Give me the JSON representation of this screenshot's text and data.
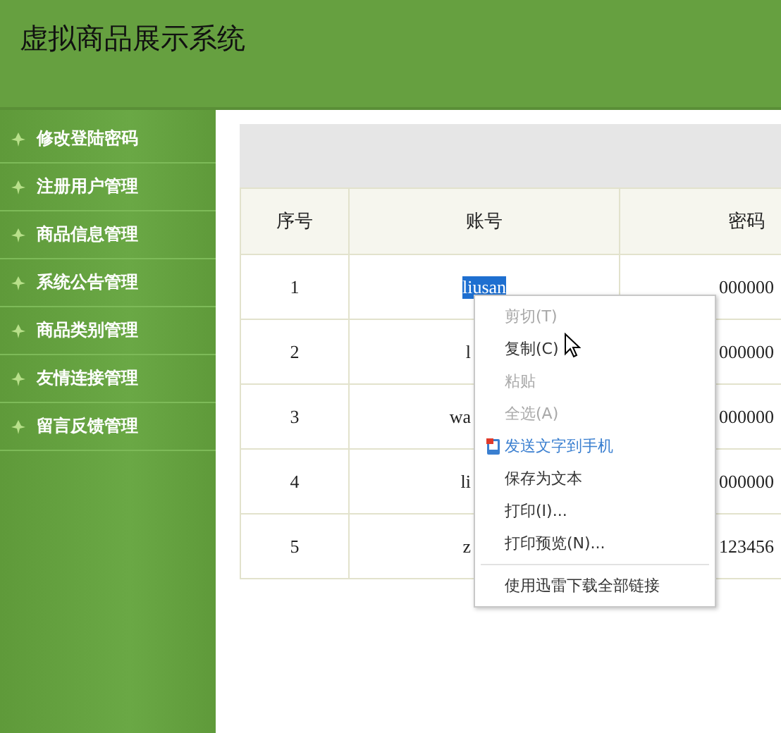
{
  "header": {
    "title": "虚拟商品展示系统"
  },
  "sidebar": {
    "items": [
      {
        "label": "修改登陆密码"
      },
      {
        "label": "注册用户管理"
      },
      {
        "label": "商品信息管理"
      },
      {
        "label": "系统公告管理"
      },
      {
        "label": "商品类别管理"
      },
      {
        "label": "友情连接管理"
      },
      {
        "label": "留言反馈管理"
      }
    ]
  },
  "table": {
    "columns": [
      "序号",
      "账号",
      "密码"
    ],
    "rows": [
      {
        "cells": [
          {
            "text": "1"
          },
          {
            "text": "liusan",
            "selected": true,
            "covered": false
          },
          {
            "text": "000000"
          }
        ]
      },
      {
        "cells": [
          {
            "text": "2"
          },
          {
            "text": "l",
            "selected": false,
            "covered": true
          },
          {
            "text": "000000"
          }
        ]
      },
      {
        "cells": [
          {
            "text": "3"
          },
          {
            "text": "wa",
            "selected": false,
            "covered": true
          },
          {
            "text": "000000"
          }
        ]
      },
      {
        "cells": [
          {
            "text": "4"
          },
          {
            "text": "li",
            "selected": false,
            "covered": true
          },
          {
            "text": "000000"
          }
        ]
      },
      {
        "cells": [
          {
            "text": "5"
          },
          {
            "text": "z",
            "selected": false,
            "covered": true
          },
          {
            "text": "123456"
          }
        ]
      }
    ]
  },
  "context_menu": {
    "items": [
      {
        "kind": "item",
        "label": "剪切(T)",
        "disabled": true
      },
      {
        "kind": "item",
        "label": "复制(C)",
        "disabled": false
      },
      {
        "kind": "item",
        "label": "粘贴",
        "disabled": true
      },
      {
        "kind": "item",
        "label": "全选(A)",
        "disabled": true
      },
      {
        "kind": "send",
        "label": "发送文字到手机",
        "disabled": false
      },
      {
        "kind": "item",
        "label": "保存为文本",
        "disabled": false
      },
      {
        "kind": "item",
        "label": "打印(I)...",
        "disabled": false
      },
      {
        "kind": "item",
        "label": "打印预览(N)...",
        "disabled": false
      },
      {
        "kind": "separator"
      },
      {
        "kind": "item",
        "label": "使用迅雷下载全部链接",
        "disabled": false
      }
    ]
  }
}
